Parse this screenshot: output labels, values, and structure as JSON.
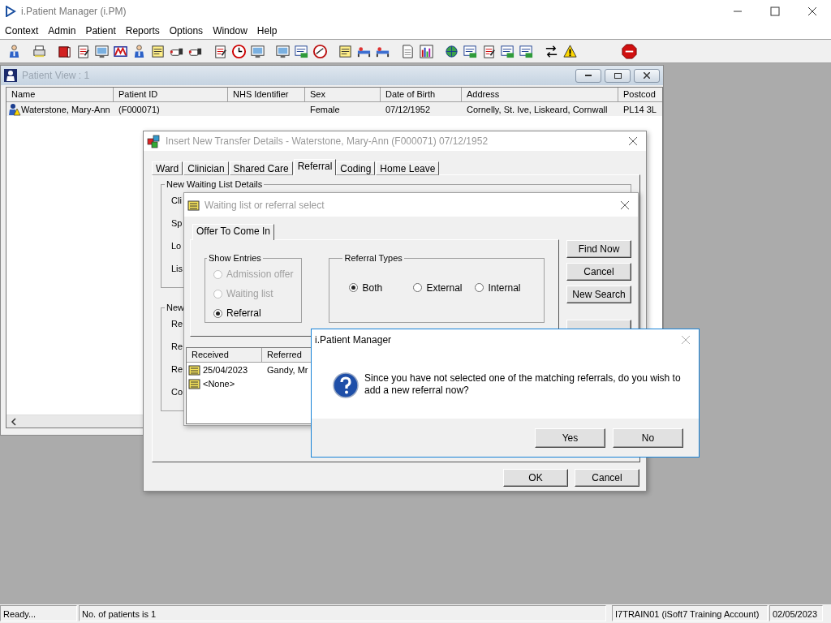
{
  "app": {
    "title": "i.Patient Manager (i.PM)"
  },
  "menu": [
    "Context",
    "Admin",
    "Patient",
    "Reports",
    "Options",
    "Window",
    "Help"
  ],
  "patient_view": {
    "title": "Patient View : 1",
    "columns": [
      "Name",
      "Patient ID",
      "NHS Identifier",
      "Sex",
      "Date of Birth",
      "Address",
      "Postcod"
    ],
    "rows": [
      {
        "name": "Waterstone, Mary-Ann",
        "patient_id": "(F000071)",
        "sex": "Female",
        "date_of_birth": "07/12/1952",
        "address": "Cornelly, St. Ive, Liskeard, Cornwall",
        "postcode": "PL14 3L",
        "selected": true
      }
    ]
  },
  "transfer_dialog": {
    "title": "Insert New Transfer Details - Waterstone, Mary-Ann (F000071) 07/12/1952",
    "tabs": [
      {
        "label": "Ward",
        "selected": false
      },
      {
        "label": "Clinician",
        "selected": false
      },
      {
        "label": "Shared Care",
        "selected": false
      },
      {
        "label": "Referral",
        "selected": true
      },
      {
        "label": "Coding",
        "selected": false
      },
      {
        "label": "Home Leave",
        "selected": false
      }
    ],
    "groups": [
      {
        "title": "New Waiting List Details",
        "labels": [
          "Cli",
          "Sp",
          "Lo",
          "Lis"
        ]
      },
      {
        "title": "New",
        "labels": [
          "Re",
          "Re",
          "Re",
          "Co"
        ]
      }
    ],
    "buttons": [
      "OK",
      "Cancel"
    ]
  },
  "referral_dialog": {
    "title": "Waiting list or referral select",
    "tabs": [
      {
        "label": "Offer To Come In",
        "selected": true
      }
    ],
    "show_entries": {
      "title": "Show Entries",
      "options": [
        {
          "label": "Admission offer",
          "checked": false,
          "disabled": true
        },
        {
          "label": "Waiting list",
          "checked": false,
          "disabled": true
        },
        {
          "label": "Referral",
          "checked": true,
          "disabled": false
        }
      ]
    },
    "referral_types": {
      "title": "Referral Types",
      "options": [
        {
          "label": "Both",
          "checked": true
        },
        {
          "label": "External",
          "checked": false
        },
        {
          "label": "Internal",
          "checked": false
        }
      ]
    },
    "buttons": [
      "Find Now",
      "Cancel",
      "New Search"
    ],
    "columns": [
      "Received",
      "Referred"
    ],
    "rows": [
      {
        "received": "25/04/2023",
        "referred_to": "Gandy, Mr"
      },
      {
        "received": "<None>"
      }
    ]
  },
  "message_box": {
    "title": "i.Patient Manager",
    "message": "Since you have not selected one of the matching referrals, do you wish to add a new referral now?",
    "buttons": [
      "Yes",
      "No"
    ]
  },
  "status_bar": [
    "Ready...",
    "No. of patients is 1",
    "I7TRAIN01 (iSoft7 Training Account)",
    "02/05/2023"
  ]
}
